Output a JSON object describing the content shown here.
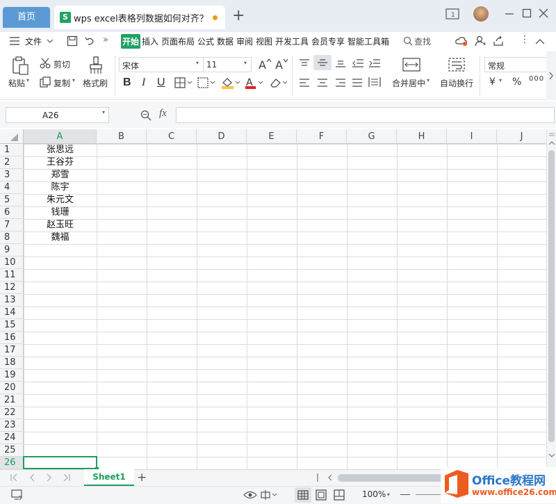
{
  "tabs": {
    "home": "首页",
    "document": "wps excel表格列数据如何对齐？",
    "new_tab": "+"
  },
  "menu": {
    "file": "文件",
    "items": [
      "开始",
      "插入",
      "页面布局",
      "公式",
      "数据",
      "审阅",
      "视图",
      "开发工具",
      "会员专享",
      "智能工具箱"
    ],
    "active": "开始",
    "search": "查找"
  },
  "ribbon": {
    "paste": "粘贴",
    "cut": "剪切",
    "copy": "复制",
    "format_painter": "格式刷",
    "font_name": "宋体",
    "font_size": "11",
    "merge_center": "合并居中",
    "wrap_text": "自动换行",
    "number_format": "常规",
    "currency_symbol": "¥",
    "percent_symbol": "%",
    "thousands_symbol": "000"
  },
  "formula_bar": {
    "name_box": "A26",
    "fx": "fx",
    "formula": ""
  },
  "columns": [
    "A",
    "B",
    "C",
    "D",
    "E",
    "F",
    "G",
    "H",
    "I",
    "J"
  ],
  "rows": [
    "1",
    "2",
    "3",
    "4",
    "5",
    "6",
    "7",
    "8",
    "9",
    "10",
    "11",
    "12",
    "13",
    "14",
    "15",
    "16",
    "17",
    "18",
    "19",
    "20",
    "21",
    "22",
    "23",
    "24",
    "25",
    "26"
  ],
  "cells_A": [
    "张思远",
    "王谷芬",
    "郑雪",
    "陈宇",
    "朱元文",
    "钱珊",
    "赵玉旺",
    "魏福"
  ],
  "active_cell": "A26",
  "sheet": {
    "name": "Sheet1",
    "add": "+"
  },
  "status": {
    "zoom": "100%"
  },
  "watermark": {
    "brand": "Office教程网",
    "url": "www.office26.com"
  },
  "colors": {
    "accent_green": "#20a162",
    "tab_blue": "#5b9bd5",
    "active_cell_border": "#1e9e5e",
    "brand_orange": "#ec5b1f"
  }
}
